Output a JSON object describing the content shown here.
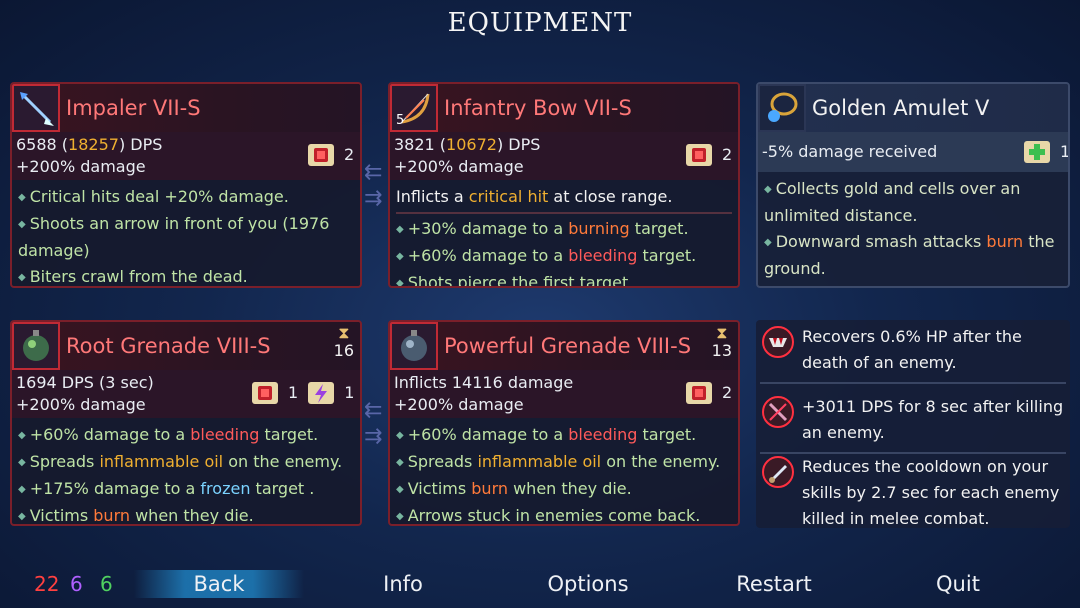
{
  "title": "EQUIPMENT",
  "weapon1": {
    "name": "Impaler VII-S",
    "dps": "6588",
    "dps_crit": "18257",
    "dps_suffix": "DPS",
    "damage_bonus": "+200% damage",
    "scroll_count": "2",
    "effects": [
      "Critical hits deal +20% damage.",
      "Shoots an arrow in front of you (1976 damage)",
      "Biters crawl from the dead."
    ]
  },
  "weapon2": {
    "name": "Infantry Bow VII-S",
    "dps": "3821",
    "dps_crit": "10672",
    "dps_suffix": "DPS",
    "damage_bonus": "+200% damage",
    "scroll_count": "2",
    "icon_badge": "5",
    "desc_pre": "Inflicts a ",
    "desc_hl": "critical hit",
    "desc_post": " at close range.",
    "effects": [
      {
        "pre": "+30% damage to a ",
        "hl": "burning",
        "post": " target."
      },
      {
        "pre": "+60% damage to a ",
        "hl": "bleeding",
        "post": " target."
      },
      {
        "pre": "Shots pierce the first target",
        "hl": "",
        "post": ""
      }
    ]
  },
  "amulet": {
    "name": "Golden Amulet V",
    "stat": "-5% damage received",
    "scroll_count": "1",
    "effects": [
      {
        "pre": "Collects gold and cells over an unlimited distance.",
        "hl": "",
        "post": ""
      },
      {
        "pre": "Downward smash attacks ",
        "hl": "burn",
        "post": " the ground."
      }
    ]
  },
  "skill1": {
    "name": "Root Grenade VIII-S",
    "cooldown": "16",
    "stat": "1694 DPS (3 sec)",
    "damage_bonus": "+200% damage",
    "scroll_red": "1",
    "scroll_purple": "1",
    "effects": [
      {
        "pre": "+60% damage to a ",
        "hl": "bleeding",
        "cls": "hl-bleed",
        "post": " target."
      },
      {
        "pre": "Spreads ",
        "hl": "inflammable oil",
        "cls": "hl-oil",
        "post": " on the enemy."
      },
      {
        "pre": "+175% damage to a ",
        "hl": "frozen",
        "cls": "hl-frozen",
        "post": " target ."
      },
      {
        "pre": "Victims ",
        "hl": "burn",
        "cls": "hl-burn",
        "post": " when they die."
      }
    ]
  },
  "skill2": {
    "name": "Powerful Grenade VIII-S",
    "cooldown": "13",
    "stat": "Inflicts 14116 damage",
    "damage_bonus": "+200% damage",
    "scroll_count": "2",
    "effects": [
      {
        "pre": "+60% damage to a ",
        "hl": "bleeding",
        "cls": "hl-bleed",
        "post": " target."
      },
      {
        "pre": "Spreads ",
        "hl": "inflammable oil",
        "cls": "hl-oil",
        "post": " on the enemy."
      },
      {
        "pre": "Victims ",
        "hl": "burn",
        "cls": "hl-burn",
        "post": " when they die."
      },
      {
        "pre": "Arrows stuck in enemies come back.",
        "hl": "",
        "cls": "",
        "post": ""
      }
    ]
  },
  "mutations": [
    "Recovers 0.6% HP after the death of an enemy.",
    "+3011 DPS for 8 sec after killing an enemy.",
    "Reduces the cooldown on your skills by 2.7 sec for each enemy killed in melee combat."
  ],
  "stats": {
    "brutality": "22",
    "tactics": "6",
    "survival": "6"
  },
  "nav": {
    "back": "Back",
    "info": "Info",
    "options": "Options",
    "restart": "Restart",
    "quit": "Quit"
  },
  "colors": {
    "brutality": "#ff4040",
    "tactics": "#b060ff",
    "survival": "#50d060"
  }
}
